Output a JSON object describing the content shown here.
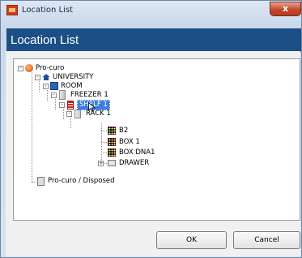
{
  "window": {
    "title": "Location List",
    "close_glyph": "x"
  },
  "header": {
    "title": "Location List"
  },
  "tree": {
    "root": "Pro-curo",
    "university": "UNIVERSITY",
    "room": "ROOM",
    "freezer": "FREEZER 1",
    "shelf": "SHELF 1",
    "rack": "RACK 1",
    "b2": "B2",
    "box1": "BOX 1",
    "boxdna": "BOX DNA1",
    "drawer": "DRAWER",
    "disposed": "Pro-curo / Disposed",
    "expand_glyph": "+",
    "collapse_glyph": "-"
  },
  "buttons": {
    "ok": "OK",
    "cancel": "Cancel"
  },
  "colors": {
    "header": "#1c4f86",
    "selection": "#3b7de0",
    "close": "#c9462a"
  }
}
